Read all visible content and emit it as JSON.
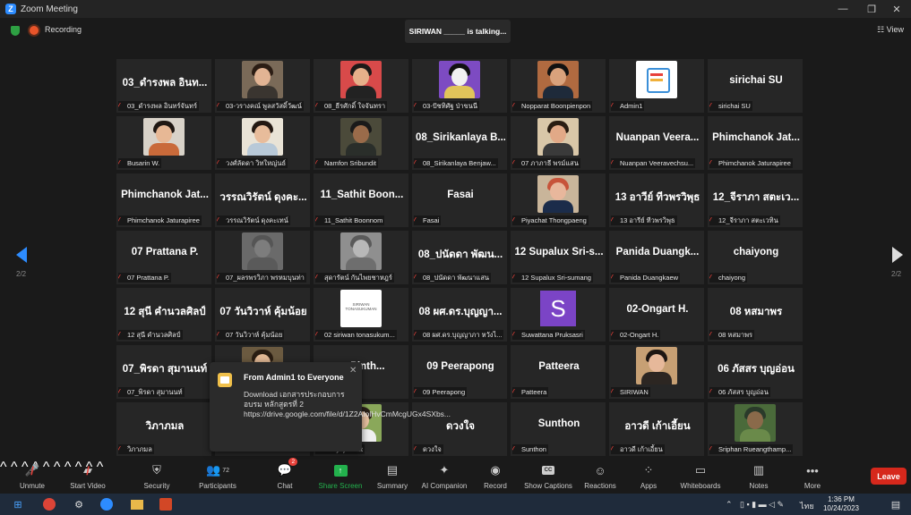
{
  "window": {
    "title": "Zoom Meeting",
    "minimize": "—",
    "maximize": "❐",
    "close": "✕"
  },
  "topbar": {
    "recording": "Recording",
    "talking": "SIRIWAN _____ is talking...",
    "view": "View"
  },
  "pager": {
    "left": "2/2",
    "right": "2/2"
  },
  "tiles": [
    {
      "name": "03_ดำรงพล อินท...",
      "label": "03_ดำรงพล อินทร์จันทร์"
    },
    {
      "name": "",
      "label": "03-วรางคณ์ พูลสวัสดิ์วัฒน์"
    },
    {
      "name": "",
      "label": "08_ธีรศักดิ์ ใจจันทรา"
    },
    {
      "name": "",
      "label": "03-ปัชทิศัฐ ป่าขนนี"
    },
    {
      "name": "",
      "label": "Nopparat Boonpienpon"
    },
    {
      "name": "",
      "label": "Admin1"
    },
    {
      "name": "sirichai SU",
      "label": "sirichai SU"
    },
    {
      "name": "",
      "label": "Busarin W."
    },
    {
      "name": "",
      "label": "วงศ์ลัดดา วิทใหญ่นธ์"
    },
    {
      "name": "",
      "label": "Namfon Sribundit"
    },
    {
      "name": "08_Sirikanlaya B...",
      "label": "08_Sirikanlaya Benjaw..."
    },
    {
      "name": "",
      "label": "07 ภาภาธี พรม์แสน"
    },
    {
      "name": "Nuanpan Veera...",
      "label": "Nuanpan Veeravechsu..."
    },
    {
      "name": "Phimchanok Jat...",
      "label": "Phimchanok Jaturapiree"
    },
    {
      "name": "Phimchanok Jat...",
      "label": "Phimchanok Jaturapiree"
    },
    {
      "name": "วรรณวิรัตน์ ดุงคะ...",
      "label": "วรรณวิรัตน์ ดุงคะเทน์"
    },
    {
      "name": "11_Sathit Boon...",
      "label": "11_Sathit Boonnom"
    },
    {
      "name": "Fasai",
      "label": "Fasai"
    },
    {
      "name": "",
      "label": "Piyachat Thongpaeng"
    },
    {
      "name": "13 อาวีย์ ทีวพรวิพุธ",
      "label": "13 อารีย์ ทีวพรวิพุธ"
    },
    {
      "name": "12_จีราภา สตะเว...",
      "label": "12_จีราภา สตะเวทิน"
    },
    {
      "name": "07 Prattana P.",
      "label": "07 Prattana P."
    },
    {
      "name": "",
      "label": "07_ผลรพรวิภา พรหมบุนท่า"
    },
    {
      "name": "",
      "label": "สุดารัตน์ กันไพยชาหฎร์"
    },
    {
      "name": "08_ปนัดดา พัฒน...",
      "label": "08_ปนัดดา พัฒนาแสน"
    },
    {
      "name": "12 Supalux Sri-s...",
      "label": "12 Supalux Sri-sumang"
    },
    {
      "name": "Panida Duangk...",
      "label": "Panida Duangkaew"
    },
    {
      "name": "chaiyong",
      "label": "chaiyong"
    },
    {
      "name": "12 สุนี คำนวลศิลป์",
      "label": "12 สุนี คำนวลศิลป์"
    },
    {
      "name": "07 วันวิวาห์ คุ้มน้อย",
      "label": "07 วันวิวาห์ คุ้มน้อย"
    },
    {
      "name": "",
      "label": "02 siriwan tonasukum..."
    },
    {
      "name": "08 ผศ.ดร.บุญญา...",
      "label": "08 ผศ.ดร.บุญญาภา หวังไ..."
    },
    {
      "name": "",
      "label": "Suwattana Pruksasri"
    },
    {
      "name": "02-Ongart H.",
      "label": "02-Ongart H."
    },
    {
      "name": "08 หสมาพร",
      "label": "08 หสมาพร"
    },
    {
      "name": "07_พิรดา สุมานนท์",
      "label": "07_พิรดา สุมานนท์"
    },
    {
      "name": "",
      "label": ""
    },
    {
      "name": "... Pinth...",
      "label": "Pinthong"
    },
    {
      "name": "09 Peerapong",
      "label": "09 Peerapong"
    },
    {
      "name": "Patteera",
      "label": "Patteera"
    },
    {
      "name": "",
      "label": "SIRIWAN"
    },
    {
      "name": "06 ภัสสร บุญอ่อน",
      "label": "06 ภัสสร บุญอ่อน"
    },
    {
      "name": "วิภาภมล",
      "label": "วิภาภมล"
    },
    {
      "name": "",
      "label": ""
    },
    {
      "name": "",
      "label": "Panyajirawut"
    },
    {
      "name": "ดวงใจ",
      "label": "ดวงใจ"
    },
    {
      "name": "Sunthon",
      "label": "Sunthon"
    },
    {
      "name": "อาวดี เก้าเอี้ยน",
      "label": "อาวดี เก้าเอี้ยน"
    },
    {
      "name": "",
      "label": "Sriphan Rueangthamp..."
    }
  ],
  "avatar_letter": "S",
  "siriwan_tile_text": "SIRIWAN TONASUKUMAN",
  "chat": {
    "from": "From Admin1 to Everyone",
    "message": "Download เอกสารประกอบการอบรม หลักสูตรที่ 2\nhttps://drive.google.com/file/d/1Z2AIolHvCmMcgUGx4SXbs...",
    "close": "✕"
  },
  "toolbar": {
    "unmute": "Unmute",
    "start_video": "Start Video",
    "security": "Security",
    "participants": "Participants",
    "participants_count": "72",
    "chat": "Chat",
    "chat_badge": "2",
    "share_screen": "Share Screen",
    "summary": "Summary",
    "ai_companion": "AI Companion",
    "record": "Record",
    "show_captions": "Show Captions",
    "cc": "CC",
    "reactions": "Reactions",
    "apps": "Apps",
    "whiteboards": "Whiteboards",
    "notes": "Notes",
    "more": "More",
    "leave": "Leave"
  },
  "taskbar": {
    "time": "1:36 PM",
    "date": "10/24/2023",
    "lang": "ไทย"
  },
  "colors": {
    "accent": "#2d8cff",
    "leave": "#d6281c",
    "share": "#23b14d",
    "muted": "#e8413a"
  }
}
